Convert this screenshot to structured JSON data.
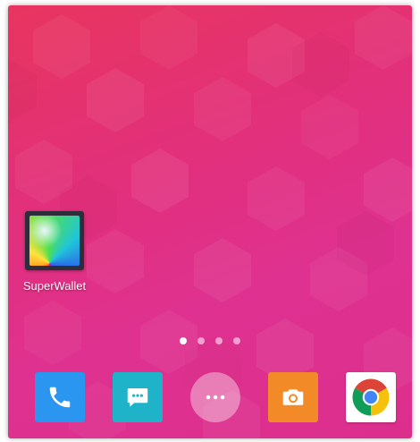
{
  "home_screen": {
    "shortcut": {
      "label": "SuperWallet",
      "icon": "superwallet-rainbow-icon"
    },
    "page_indicator": {
      "pages": 4,
      "current_page": 1
    },
    "dock": {
      "items": [
        {
          "icon": "phone-icon",
          "color": "#2b96f0"
        },
        {
          "icon": "chat-bubble-icon",
          "color": "#1fb3c9"
        },
        {
          "icon": "app-drawer-icon",
          "color": "#ffffff"
        },
        {
          "icon": "camera-icon",
          "color": "#f28a28"
        },
        {
          "icon": "chrome-icon",
          "color": "#ffffff"
        }
      ]
    }
  },
  "colors": {
    "wallpaper_top": "#e8355f",
    "wallpaper_bottom": "#dc2f8d",
    "label_text": "#ffffff"
  }
}
